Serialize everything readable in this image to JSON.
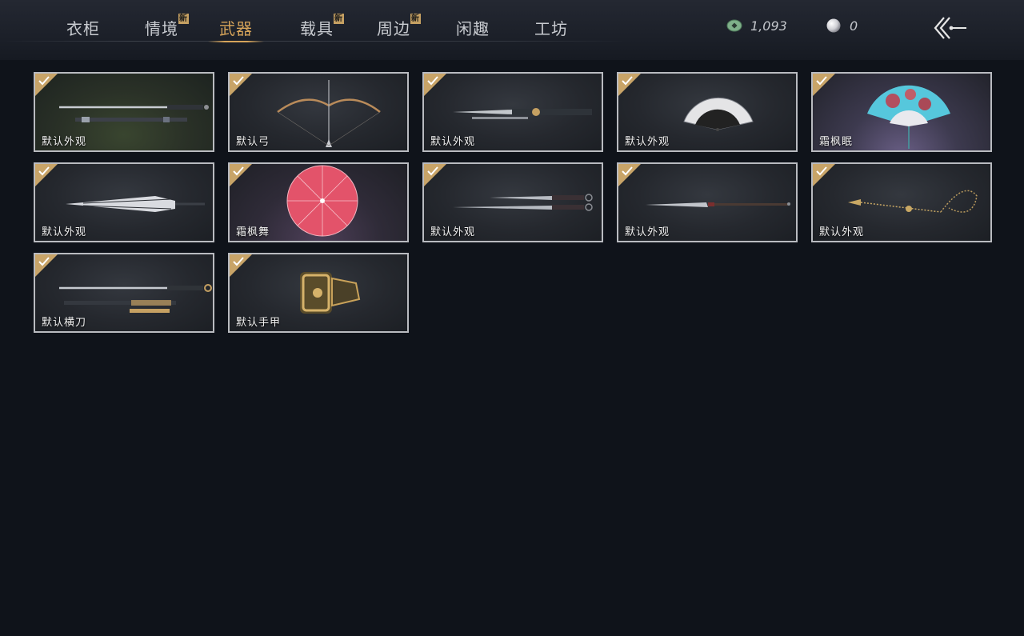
{
  "tabs": [
    {
      "label": "衣柜",
      "new": false,
      "active": false
    },
    {
      "label": "情境",
      "new": true,
      "active": false
    },
    {
      "label": "武器",
      "new": false,
      "active": true
    },
    {
      "label": "载具",
      "new": true,
      "active": false
    },
    {
      "label": "周边",
      "new": true,
      "active": false
    },
    {
      "label": "闲趣",
      "new": false,
      "active": false
    },
    {
      "label": "工坊",
      "new": false,
      "active": false
    }
  ],
  "new_badge_text": "新",
  "currency": {
    "coins": {
      "value": "1,093",
      "icon": "jade-coin-icon"
    },
    "pearls": {
      "value": "0",
      "icon": "pearl-icon"
    }
  },
  "items": [
    {
      "label": "默认外观",
      "owned": true,
      "art": "sword-and-scabbard"
    },
    {
      "label": "默认弓",
      "owned": true,
      "art": "bow"
    },
    {
      "label": "默认外观",
      "owned": true,
      "art": "twin-blades"
    },
    {
      "label": "默认外观",
      "owned": true,
      "art": "folding-fan"
    },
    {
      "label": "霜枫眠",
      "owned": true,
      "art": "blue-fan"
    },
    {
      "label": "默认外观",
      "owned": true,
      "art": "umbrella-closed"
    },
    {
      "label": "霜枫舞",
      "owned": true,
      "art": "red-umbrella"
    },
    {
      "label": "默认外观",
      "owned": true,
      "art": "dual-swords"
    },
    {
      "label": "默认外观",
      "owned": true,
      "art": "spear"
    },
    {
      "label": "默认外观",
      "owned": true,
      "art": "rope-dart"
    },
    {
      "label": "默认横刀",
      "owned": true,
      "art": "hengdao"
    },
    {
      "label": "默认手甲",
      "owned": true,
      "art": "gauntlet"
    }
  ],
  "colors": {
    "accent": "#d6a45a",
    "badge": "#c5a062",
    "background": "#0f131a"
  }
}
